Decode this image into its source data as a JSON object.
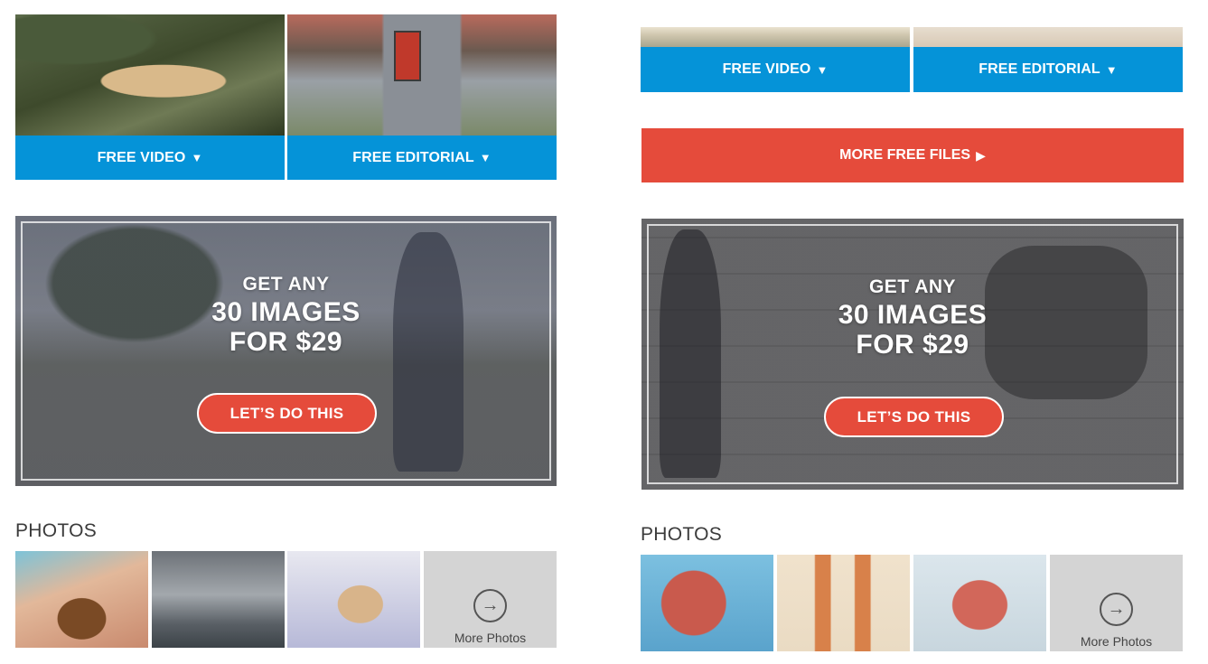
{
  "left": {
    "category_buttons": [
      {
        "label": "FREE VIDEO",
        "arrow": "▼"
      },
      {
        "label": "FREE EDITORIAL",
        "arrow": "▼"
      }
    ],
    "promo": {
      "line1": "GET ANY",
      "line2": "30 IMAGES",
      "line3": "FOR $29",
      "cta": "LET’S DO THIS"
    },
    "photos": {
      "title": "PHOTOS",
      "more_label": "More Photos",
      "more_icon": "→"
    }
  },
  "right": {
    "category_buttons": [
      {
        "label": "FREE VIDEO",
        "arrow": "▼"
      },
      {
        "label": "FREE EDITORIAL",
        "arrow": "▼"
      }
    ],
    "more_free_files": {
      "label": "MORE FREE FILES",
      "arrow": "▶"
    },
    "promo": {
      "line1": "GET ANY",
      "line2": "30 IMAGES",
      "line3": "FOR $29",
      "cta": "LET’S DO THIS"
    },
    "photos": {
      "title": "PHOTOS",
      "more_label": "More Photos",
      "more_icon": "→"
    }
  },
  "colors": {
    "blue": "#0593d8",
    "red": "#e54b3b",
    "gray_tile": "#d4d4d4"
  },
  "icons": {
    "arrow_down": "triangle-down-icon",
    "arrow_right": "triangle-right-icon",
    "more_photos": "circle-arrow-right-icon"
  }
}
